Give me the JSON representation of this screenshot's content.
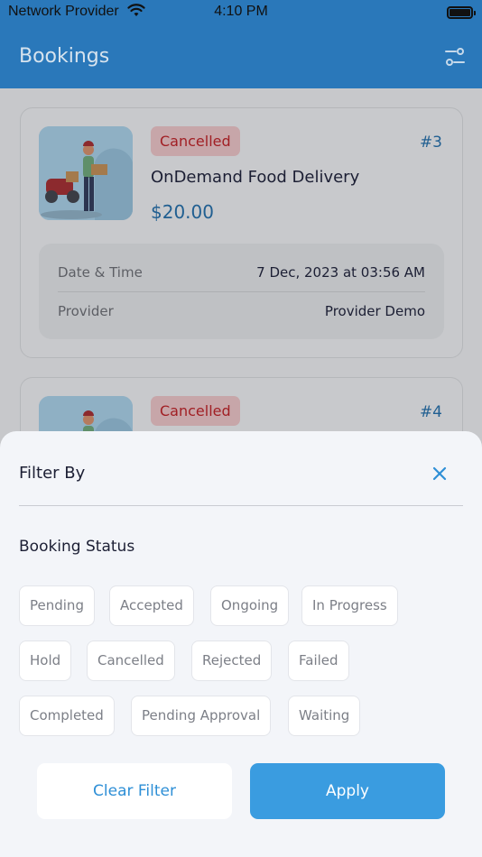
{
  "status_bar": {
    "carrier": "Network Provider",
    "time": "4:10 PM",
    "wifi_icon": "wifi-icon",
    "battery_icon": "battery-icon"
  },
  "header": {
    "title": "Bookings",
    "filter_icon": "sliders-icon"
  },
  "bookings": [
    {
      "status": "Cancelled",
      "id": "#3",
      "service": "OnDemand Food Delivery",
      "price": "$20.00",
      "details": [
        {
          "label": "Date & Time",
          "value": "7 Dec, 2023 at 03:56 AM"
        },
        {
          "label": "Provider",
          "value": "Provider Demo"
        }
      ]
    },
    {
      "status": "Cancelled",
      "id": "#4"
    }
  ],
  "filter_sheet": {
    "title": "Filter By",
    "close_icon": "close-icon",
    "section_title": "Booking Status",
    "chips": [
      "Pending",
      "Accepted",
      "Ongoing",
      "In Progress",
      "Hold",
      "Cancelled",
      "Rejected",
      "Failed",
      "Completed",
      "Pending Approval",
      "Waiting"
    ],
    "clear_label": "Clear Filter",
    "apply_label": "Apply"
  },
  "colors": {
    "primary": "#2a78ba",
    "accent": "#3a9ce0",
    "cancelled": "#a11f24"
  }
}
